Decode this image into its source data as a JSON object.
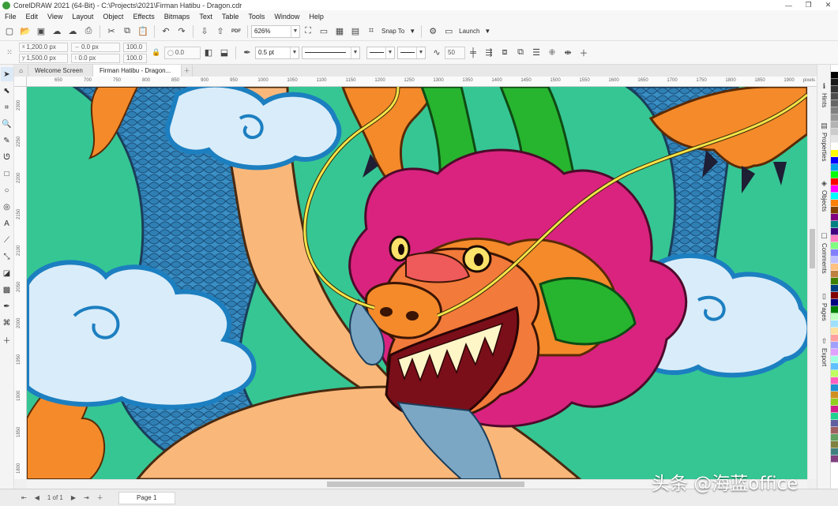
{
  "window": {
    "title": "CorelDRAW 2021 (64-Bit) - C:\\Projects\\2021\\Firman Hatibu - Dragon.cdr",
    "controls": [
      "minimize",
      "restore",
      "close"
    ]
  },
  "menu": [
    "File",
    "Edit",
    "View",
    "Layout",
    "Object",
    "Effects",
    "Bitmaps",
    "Text",
    "Table",
    "Tools",
    "Window",
    "Help"
  ],
  "toolbar": {
    "pdf_label": "PDF",
    "zoom": "626%",
    "snap_to": "Snap To",
    "launch": "Launch"
  },
  "property_bar": {
    "x": "1,200.0 px",
    "y": "1,500.0 px",
    "w": "0.0 px",
    "h": "0.0 px",
    "scale_x": "100.0",
    "scale_y": "100.0",
    "angle": "0.0",
    "outline_width": "0.5 pt",
    "smoothing": "50"
  },
  "tabs": [
    {
      "label": "Welcome Screen"
    },
    {
      "label": "Firman Hatibu - Dragon..."
    }
  ],
  "ruler": {
    "unit": "pixels",
    "h_ticks": [
      "650",
      "700",
      "750",
      "800",
      "850",
      "900",
      "950",
      "1000",
      "1050",
      "1100",
      "1150",
      "1200",
      "1250",
      "1300",
      "1350",
      "1400",
      "1450",
      "1500",
      "1550",
      "1600",
      "1650",
      "1700",
      "1750",
      "1800",
      "1850",
      "1900"
    ],
    "v_ticks": [
      "2300",
      "2250",
      "2200",
      "2150",
      "2100",
      "2050",
      "2000",
      "1950",
      "1900",
      "1850",
      "1800"
    ]
  },
  "dock": [
    {
      "label": "Hints"
    },
    {
      "label": "Properties"
    },
    {
      "label": "Objects"
    },
    {
      "label": "Comments"
    },
    {
      "label": "Pages"
    },
    {
      "label": "Export"
    }
  ],
  "palette": [
    "#ffffff",
    "#000000",
    "#1a1a1a",
    "#333333",
    "#4d4d4d",
    "#666666",
    "#808080",
    "#999999",
    "#b3b3b3",
    "#cccccc",
    "#e6e6e6",
    "#ffffff",
    "#ffff00",
    "#0000ff",
    "#00a0e9",
    "#00ff00",
    "#ff0000",
    "#ff00ff",
    "#00ffff",
    "#ff8000",
    "#804000",
    "#800080",
    "#008080",
    "#400080",
    "#ff80c0",
    "#80ff80",
    "#8080ff",
    "#c0c0ff",
    "#ffc080",
    "#c08040",
    "#408000",
    "#004080",
    "#800000",
    "#000080",
    "#008000",
    "#c0ffc0",
    "#a0e0ff",
    "#ffe0a0",
    "#ffa0a0",
    "#a0a0ff",
    "#e0a0ff",
    "#a0ffe0",
    "#60c0ff",
    "#c0ff60",
    "#ff60c0",
    "#2090d0",
    "#d09020",
    "#90d020",
    "#d02090",
    "#20d090",
    "#6060a0",
    "#a06060",
    "#60a060",
    "#808040",
    "#408080",
    "#804080"
  ],
  "status": {
    "page_count": "1  of  1",
    "page_tab": "Page 1"
  },
  "watermark": "头条 @海蓝office",
  "canvas_colors": {
    "background": "#35c694",
    "scales": "#3a8fc5",
    "belly": "#f9b77a",
    "mane": "#d9237f",
    "horns": "#27b52f",
    "claws": "#f48a2a",
    "cloud": "#d9ecf9",
    "whisker": "#f4e44a"
  }
}
